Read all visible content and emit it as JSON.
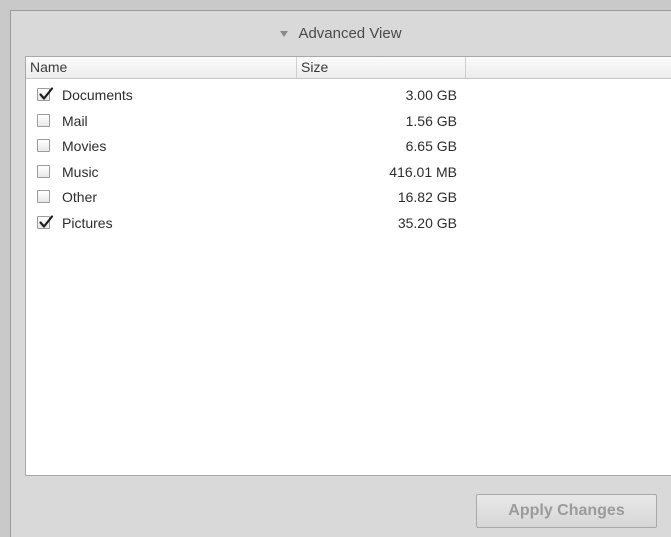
{
  "advanced_view": {
    "label": "Advanced View",
    "icon": "triangle-down-icon"
  },
  "table": {
    "columns": [
      "Name",
      "Size",
      ""
    ],
    "rows": [
      {
        "name": "Documents",
        "size": "3.00 GB",
        "checked": true
      },
      {
        "name": "Mail",
        "size": "1.56 GB",
        "checked": false
      },
      {
        "name": "Movies",
        "size": "6.65 GB",
        "checked": false
      },
      {
        "name": "Music",
        "size": "416.01 MB",
        "checked": false
      },
      {
        "name": "Other",
        "size": "16.82 GB",
        "checked": false
      },
      {
        "name": "Pictures",
        "size": "35.20 GB",
        "checked": true
      }
    ]
  },
  "footer": {
    "apply_label": "Apply Changes"
  },
  "colors": {
    "panel_bg": "#d9d9d9",
    "table_bg": "#ffffff",
    "disabled_text": "#9b9b9b"
  }
}
